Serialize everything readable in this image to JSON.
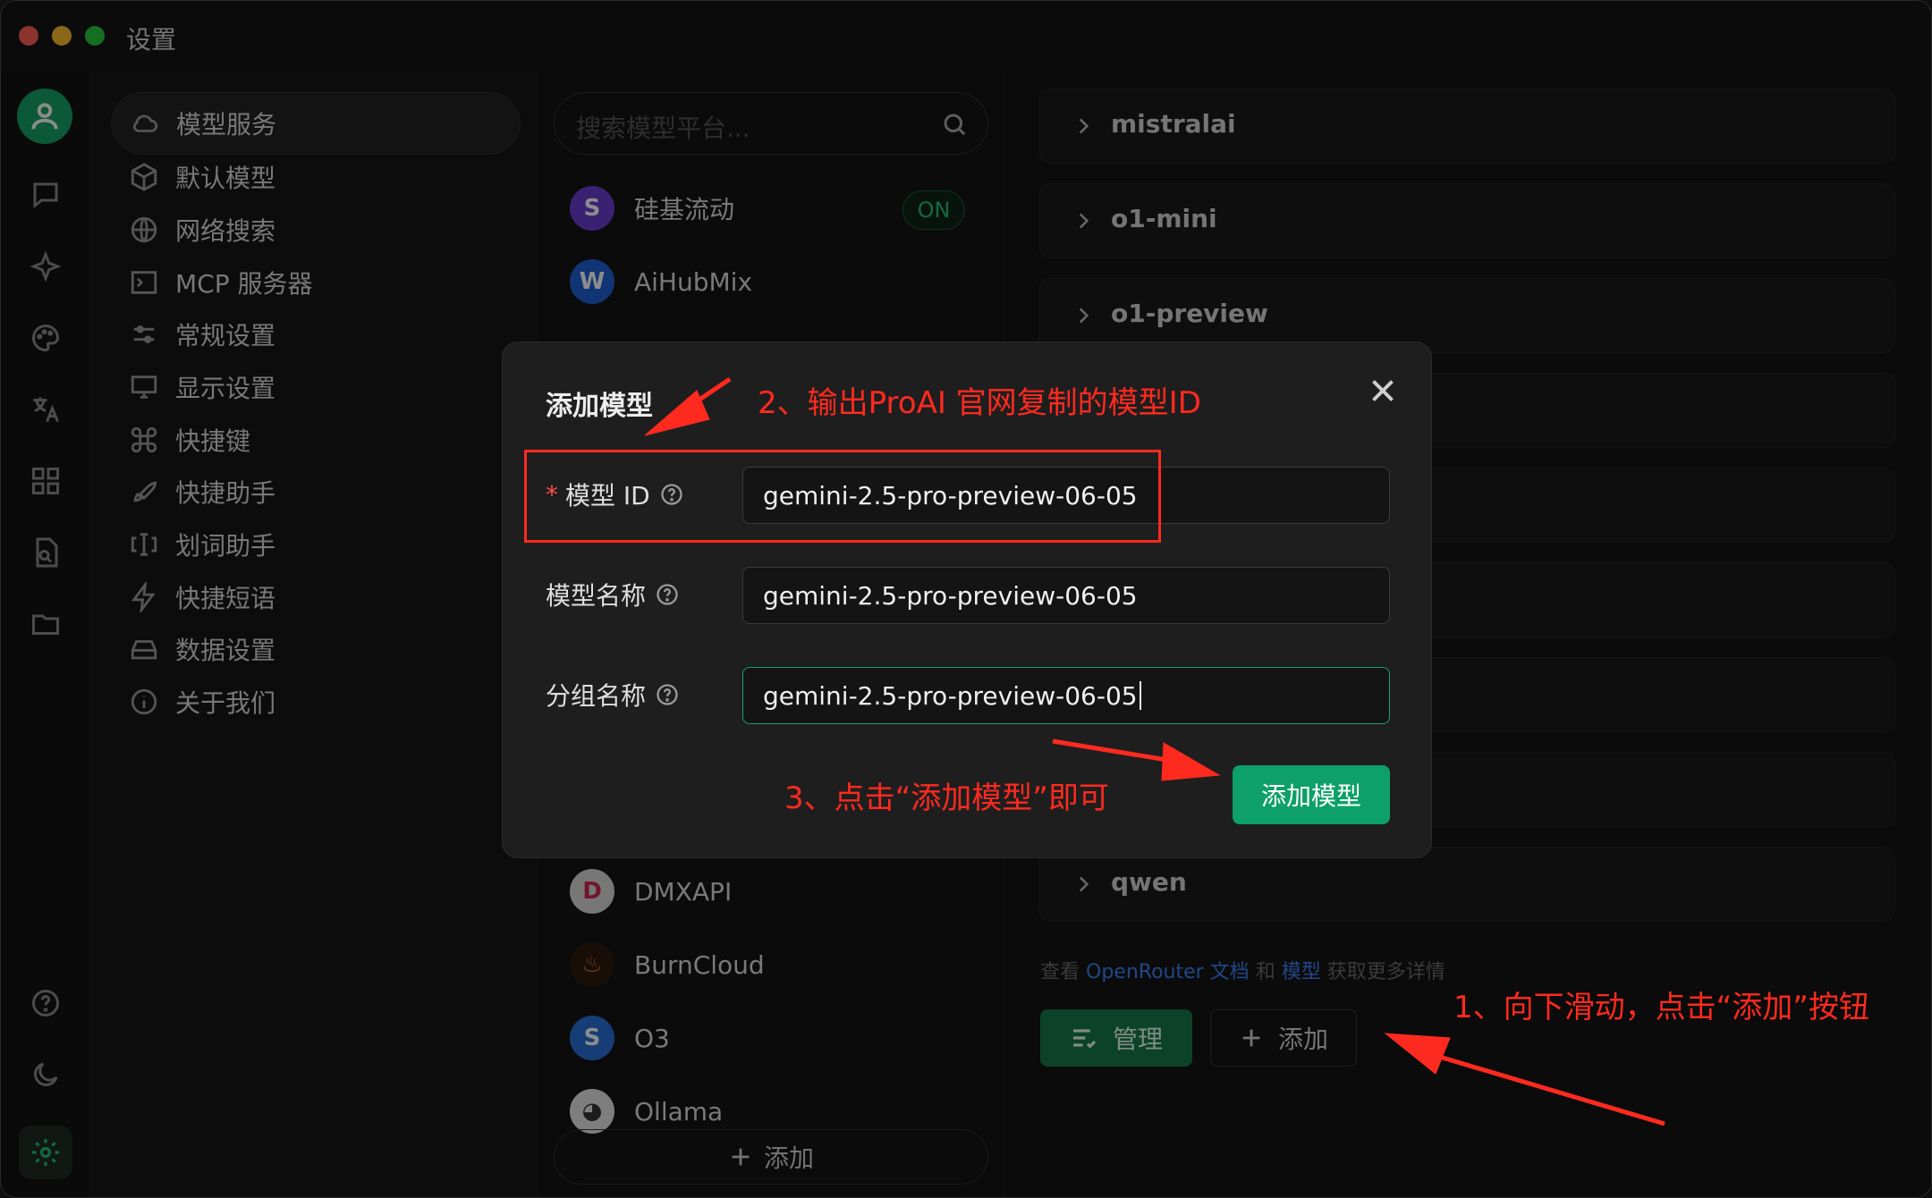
{
  "window": {
    "title": "设置"
  },
  "settings_menu": {
    "items": [
      {
        "label": "模型服务",
        "icon": "cloud-icon",
        "active": true
      },
      {
        "label": "默认模型",
        "icon": "cube-icon"
      },
      {
        "label": "网络搜索",
        "icon": "globe-icon"
      },
      {
        "label": "MCP 服务器",
        "icon": "terminal-icon"
      },
      {
        "label": "常规设置",
        "icon": "sliders-icon"
      },
      {
        "label": "显示设置",
        "icon": "monitor-icon"
      },
      {
        "label": "快捷键",
        "icon": "command-icon"
      },
      {
        "label": "快捷助手",
        "icon": "rocket-icon"
      },
      {
        "label": "划词助手",
        "icon": "text-cursor-icon"
      },
      {
        "label": "快捷短语",
        "icon": "zap-icon"
      },
      {
        "label": "数据设置",
        "icon": "hard-drive-icon"
      },
      {
        "label": "关于我们",
        "icon": "info-icon"
      }
    ]
  },
  "providers": {
    "search_placeholder": "搜索模型平台...",
    "items": [
      {
        "name": "硅基流动",
        "status": "ON",
        "color": "#6b3fd1"
      },
      {
        "name": "AiHubMix",
        "color": "#1f5fd6"
      },
      {
        "name": "DMXAPI",
        "color": "#d9d9d9"
      },
      {
        "name": "BurnCloud",
        "color": "#e0741c"
      },
      {
        "name": "O3",
        "color": "#2a6fd8"
      },
      {
        "name": "Ollama",
        "color": "#e6e6e6"
      }
    ],
    "add_label": "添加"
  },
  "models": {
    "groups": [
      "mistralai",
      "o1-mini",
      "o1-preview",
      "qwen"
    ],
    "hint_prefix": "查看",
    "hint_link1": "OpenRouter 文档",
    "hint_and": "和",
    "hint_link2": "模型",
    "hint_suffix": "获取更多详情",
    "manage_label": "管理",
    "add_label": "添加"
  },
  "dialog": {
    "title": "添加模型",
    "model_id_label": "模型 ID",
    "model_id_value": "gemini-2.5-pro-preview-06-05",
    "model_name_label": "模型名称",
    "model_name_value": "gemini-2.5-pro-preview-06-05",
    "group_name_label": "分组名称",
    "group_name_value": "gemini-2.5-pro-preview-06-05",
    "submit_label": "添加模型"
  },
  "annotations": {
    "step1": "1、向下滑动，点击“添加”按钮",
    "step2": "2、输出ProAI 官网复制的模型ID",
    "step3": "3、点击“添加模型”即可"
  },
  "colors": {
    "accent": "#17a36a",
    "annotation": "#ff2a1f"
  }
}
